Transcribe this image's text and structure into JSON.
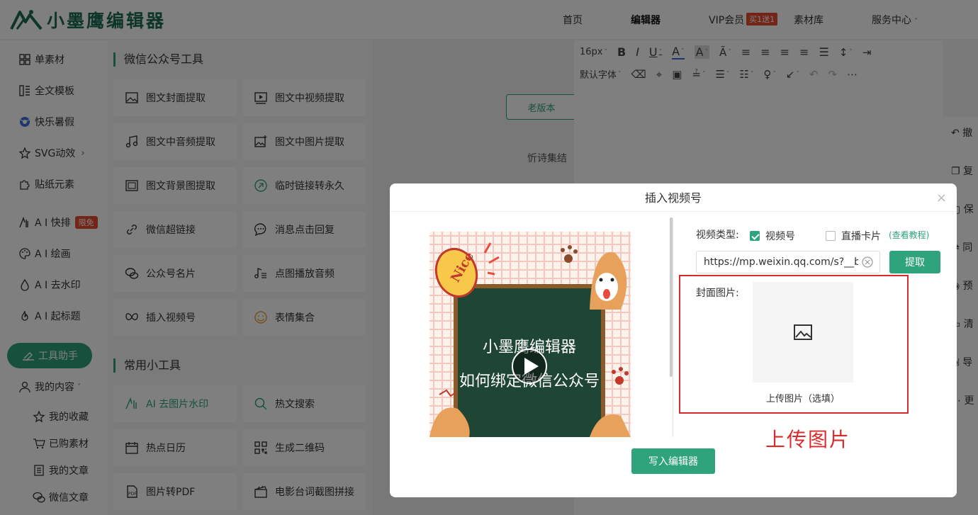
{
  "header": {
    "logo_text": "小墨鹰编辑器",
    "nav": {
      "home": "首页",
      "editor": "编辑器",
      "vip": "VIP会员",
      "vip_badge": "买1送1",
      "materials": "素材库",
      "service": "服务中心"
    }
  },
  "sidebar": {
    "items": [
      {
        "label": "单素材",
        "icon": "grid-icon"
      },
      {
        "label": "全文模板",
        "icon": "template-icon"
      },
      {
        "label": "快乐暑假",
        "icon": "ball-icon"
      },
      {
        "label": "SVG动效",
        "icon": "star-icon"
      },
      {
        "label": "贴纸元素",
        "icon": "puzzle-icon"
      },
      {
        "label": "A I 快排",
        "icon": "ai-icon",
        "badge": "限免"
      },
      {
        "label": "A I 绘画",
        "icon": "palette-icon"
      },
      {
        "label": "A I 去水印",
        "icon": "drop-icon"
      },
      {
        "label": "A I 起标题",
        "icon": "fire-icon"
      }
    ],
    "helper": "工具助手",
    "my_content": "我的内容",
    "sub_items": [
      "我的收藏",
      "已购素材",
      "我的文章",
      "微信文章"
    ]
  },
  "tools": {
    "section1_title": "微信公众号工具",
    "section1": [
      "图文封面提取",
      "图文中视频提取",
      "图文中音频提取",
      "图文中图片提取",
      "图文背景图提取",
      "临时链接转永久",
      "微信超链接",
      "消息点击回复",
      "公众号名片",
      "点图播放音频",
      "插入视频号",
      "表情集合"
    ],
    "section2_title": "常用小工具",
    "section2": [
      "AI 去图片水印",
      "热文搜索",
      "热点日历",
      "生成二维码",
      "图片转PDF",
      "电影台词截图拼接"
    ]
  },
  "middle": {
    "old_version": "老版本",
    "text": "忻诗集结"
  },
  "editor": {
    "font_size": "16px",
    "font_family": "默认字体"
  },
  "right_rail": [
    "撤",
    "复",
    "保",
    "同",
    "预",
    "清",
    "导",
    "更"
  ],
  "modal": {
    "title": "插入视频号",
    "close": "×",
    "preview_line1": "小墨鹰编辑器",
    "preview_line2": "如何绑定微信公众号",
    "preview_sticker": "Nice",
    "video_type_label": "视频类型:",
    "option_video": "视频号",
    "option_live": "直播卡片",
    "option_video_checked": true,
    "option_live_checked": false,
    "tutorial_link": "(查看教程)",
    "url_value": "https://mp.weixin.qq.com/s?__biz=",
    "extract_button": "提取",
    "cover_label": "封面图片:",
    "upload_text": "上传图片（选填）",
    "annotation": "上传图片",
    "write_button": "写入编辑器"
  },
  "colors": {
    "primary": "#2fa37c",
    "logo": "#1a6b52",
    "red": "#d92b2b",
    "badge": "#e64a2e"
  }
}
